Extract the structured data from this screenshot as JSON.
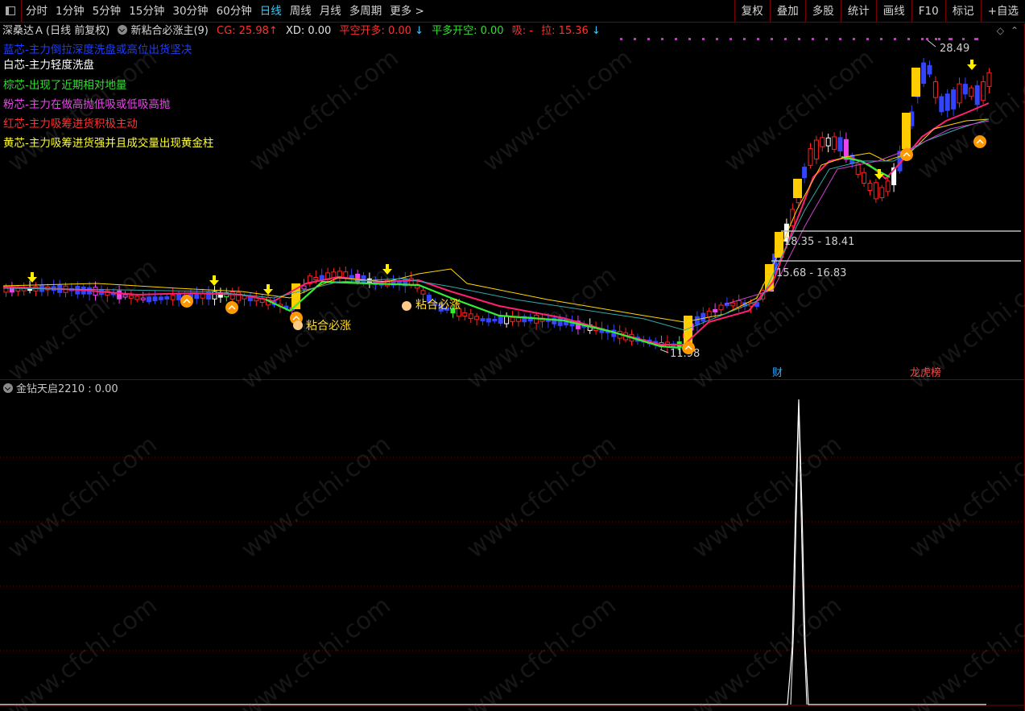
{
  "toolbar": {
    "periods": [
      "分时",
      "1分钟",
      "5分钟",
      "15分钟",
      "30分钟",
      "60分钟",
      "日线",
      "周线",
      "月线",
      "多周期",
      "更多 >"
    ],
    "active_period": "日线",
    "right_items": [
      "复权",
      "叠加",
      "多股",
      "统计",
      "画线",
      "F10",
      "标记",
      "+自选"
    ]
  },
  "indicator_line": {
    "stock": "深桑达Ａ",
    "period_info": "(日线 前复权)",
    "indicator_name": "新粘合必涨主(9)",
    "cg_label": "CG: 25.98",
    "cg_arrow": "↑",
    "xd_label": "XD: 0.00",
    "pkd_label": "平空开多: 0.00",
    "pkd_arrow": "↓",
    "pdk_label": "平多开空: 0.00",
    "xi_label": "吸: -",
    "la_label": "拉: 15.36",
    "la_arrow": "↓"
  },
  "legend": [
    {
      "text": "蓝芯-主力倒拉深度洗盘或高位出货坚决",
      "color": "#1e3cff"
    },
    {
      "text": "白芯-主力轻度洗盘",
      "color": "#ffffff"
    },
    {
      "text": "棕芯-出现了近期相对地量",
      "color": "#33dd33"
    },
    {
      "text": "粉芯-主力在做高抛低吸或低吸高抛",
      "color": "#ee44ee"
    },
    {
      "text": "红芯-主力吸筹进货积极主动",
      "color": "#ff3030"
    },
    {
      "text": "黄芯-主力吸筹进货强并且成交量出现黄金柱",
      "color": "#ffff33"
    }
  ],
  "price_labels": {
    "high": "28.49",
    "low": "11.98",
    "zone1": "18.35 - 18.41",
    "zone2": "15.68 - 16.83"
  },
  "annotations": {
    "signal1": "粘合必涨",
    "signal2": "粘合必涨",
    "fin_marker": "财",
    "dragon_marker": "龙虎榜"
  },
  "lower_indicator": {
    "name": "金钻天启2210",
    "value": ": 0.00"
  },
  "watermark": "www.cfchi.com",
  "colors": {
    "up": "#ff2020",
    "down": "#3344ff",
    "yellow_bar": "#ffcc00",
    "ma_red": "#ff2050",
    "ma_green": "#33ee33",
    "pane_border": "#7a0000"
  }
}
